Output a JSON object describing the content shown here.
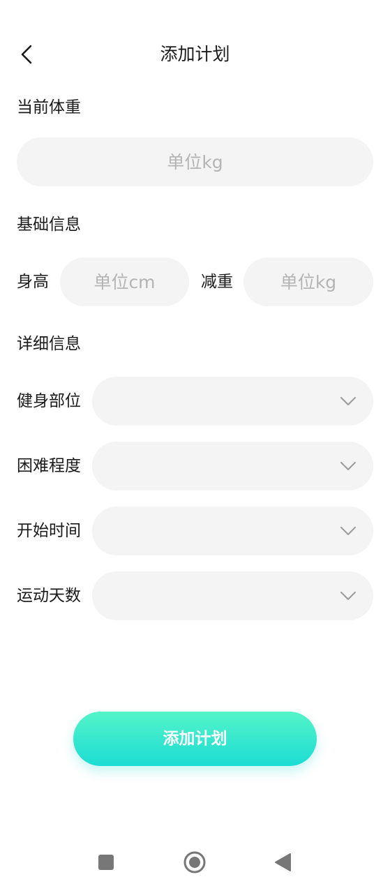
{
  "header": {
    "title": "添加计划",
    "back_icon": "chevron-left-icon"
  },
  "current_weight": {
    "section_title": "当前体重",
    "value": "",
    "placeholder": "单位kg"
  },
  "basic_info": {
    "section_title": "基础信息",
    "height_label": "身高",
    "height_value": "",
    "height_placeholder": "单位cm",
    "reduce_label": "减重",
    "reduce_value": "",
    "reduce_placeholder": "单位kg"
  },
  "detail_info": {
    "section_title": "详细信息",
    "fields": [
      {
        "label": "健身部位",
        "value": "",
        "icon": "chevron-down-icon"
      },
      {
        "label": "困难程度",
        "value": "",
        "icon": "chevron-down-icon"
      },
      {
        "label": "开始时间",
        "value": "",
        "icon": "chevron-down-icon"
      },
      {
        "label": "运动天数",
        "value": "",
        "icon": "chevron-down-icon"
      }
    ]
  },
  "submit": {
    "label": "添加计划",
    "gradient_top": "#54f4c8",
    "gradient_bottom": "#1cdcd3"
  },
  "system_nav": {
    "buttons": [
      "recents-square-icon",
      "home-circle-icon",
      "back-triangle-icon"
    ]
  },
  "colors": {
    "input_bg": "#f4f4f4",
    "placeholder": "#b4b4b4",
    "text": "#1a1a1a",
    "nav_icon": "#777777"
  }
}
